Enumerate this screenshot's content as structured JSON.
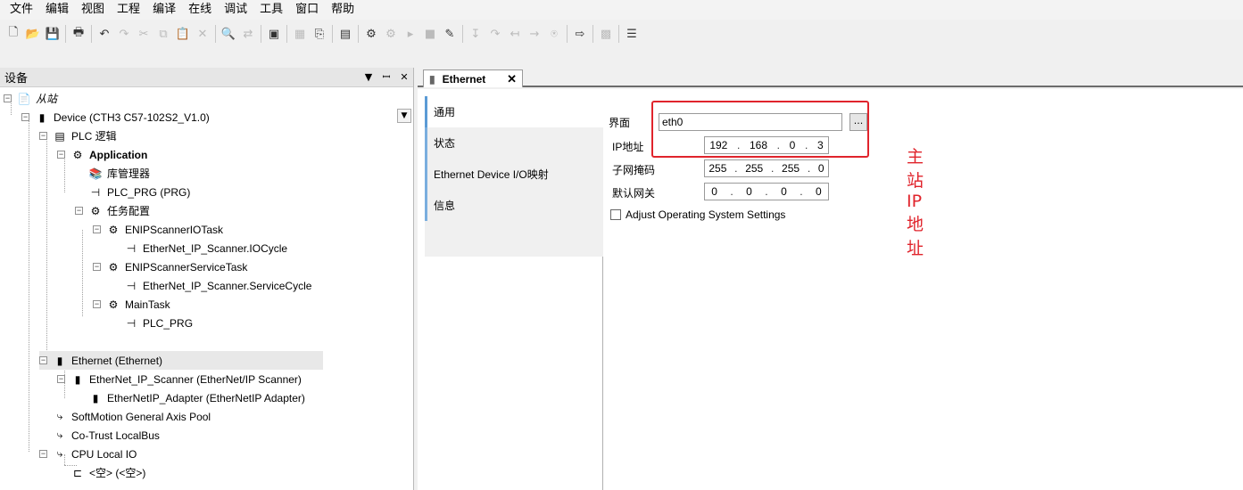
{
  "menu": [
    "文件",
    "编辑",
    "视图",
    "工程",
    "编译",
    "在线",
    "调试",
    "工具",
    "窗口",
    "帮助"
  ],
  "toolbar_icons": [
    "new-icon",
    "open-icon",
    "save-icon",
    "print-icon",
    "undo-icon",
    "redo-icon",
    "cut-icon",
    "copy-icon",
    "paste-icon",
    "delete-icon",
    "find-icon",
    "replace-icon",
    "window-icon",
    "build-icon",
    "insert-icon",
    "watch-icon",
    "login-icon",
    "logout-icon",
    "start-icon",
    "stop-icon",
    "reset-icon",
    "step-into-icon",
    "step-over-icon",
    "step-out-icon",
    "step-return-icon",
    "breakpoint-icon",
    "next-icon",
    "tool-icon",
    "toggle-icon"
  ],
  "left_panel": {
    "title": "设备",
    "pin": "▼",
    "dock": "ꟷ",
    "close": "✕",
    "tree": [
      {
        "label": "从站",
        "italic": true
      },
      {
        "label": "Device (CTH3 C57-102S2_V1.0)"
      },
      {
        "label": "PLC 逻辑"
      },
      {
        "label": "Application",
        "bold": true
      },
      {
        "label": "库管理器"
      },
      {
        "label": "PLC_PRG (PRG)"
      },
      {
        "label": "任务配置"
      },
      {
        "label": "ENIPScannerIOTask"
      },
      {
        "label": "EtherNet_IP_Scanner.IOCycle"
      },
      {
        "label": "ENIPScannerServiceTask"
      },
      {
        "label": "EtherNet_IP_Scanner.ServiceCycle"
      },
      {
        "label": "MainTask"
      },
      {
        "label": "PLC_PRG"
      },
      {
        "label": "Ethernet (Ethernet)",
        "selected": true
      },
      {
        "label": "EtherNet_IP_Scanner (EtherNet/IP Scanner)"
      },
      {
        "label": "EtherNetIP_Adapter (EtherNetIP Adapter)"
      },
      {
        "label": "SoftMotion General Axis Pool"
      },
      {
        "label": "Co-Trust LocalBus"
      },
      {
        "label": "CPU Local IO"
      },
      {
        "label": "<空> (<空>)"
      }
    ]
  },
  "editor": {
    "tab_label": "Ethernet",
    "tab_close": "✕",
    "side_tabs": [
      "通用",
      "状态",
      "Ethernet Device I/O映射",
      "信息"
    ],
    "form": {
      "interface_label": "界面",
      "interface_value": "eth0",
      "browse_label": "...",
      "ip_label": "IP地址",
      "ip_value": [
        "192",
        "168",
        "0",
        "3"
      ],
      "subnet_label": "子网掩码",
      "subnet_value": [
        "255",
        "255",
        "255",
        "0"
      ],
      "gateway_label": "默认网关",
      "gateway_value": [
        "0",
        "0",
        "0",
        "0"
      ],
      "adjust_os_label": "Adjust Operating System Settings",
      "adjust_os_checked": false
    },
    "annotation": "主站IP地址"
  },
  "colors": {
    "annotation": "#e0242c",
    "tab_accent": "#5b9bd5"
  }
}
